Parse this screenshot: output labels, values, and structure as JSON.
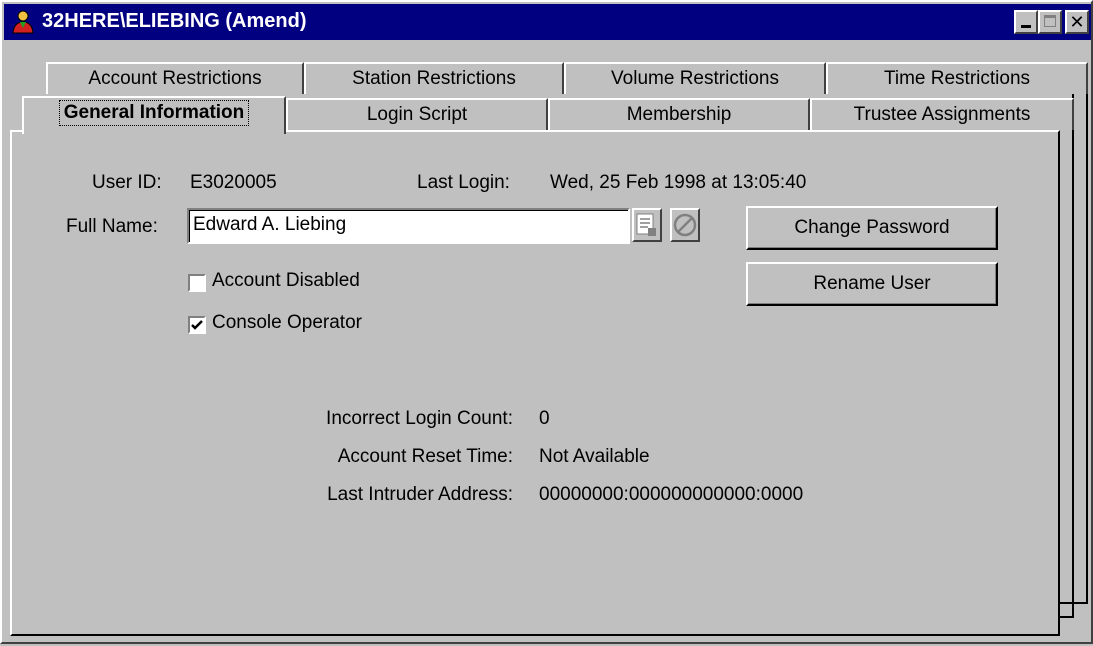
{
  "window": {
    "title": "32HERE\\ELIEBING (Amend)",
    "icon": "user-icon"
  },
  "tabs": {
    "row1": [
      "Account Restrictions",
      "Station Restrictions",
      "Volume Restrictions",
      "Time Restrictions"
    ],
    "row2": [
      "General Information",
      "Login Script",
      "Membership",
      "Trustee Assignments"
    ],
    "active": "General Information"
  },
  "general": {
    "user_id_label": "User ID:",
    "user_id_value": "E3020005",
    "last_login_label": "Last Login:",
    "last_login_value": "Wed, 25 Feb 1998 at 13:05:40",
    "full_name_label": "Full Name:",
    "full_name_value": "Edward A. Liebing",
    "account_disabled_label": "Account Disabled",
    "account_disabled_checked": false,
    "console_operator_label": "Console Operator",
    "console_operator_checked": true,
    "change_password_label": "Change Password",
    "rename_user_label": "Rename User",
    "incorrect_login_count_label": "Incorrect Login Count:",
    "incorrect_login_count_value": "0",
    "account_reset_time_label": "Account Reset Time:",
    "account_reset_time_value": "Not Available",
    "last_intruder_address_label": "Last Intruder Address:",
    "last_intruder_address_value": "00000000:000000000000:0000"
  },
  "colors": {
    "titlebar": "#000080",
    "face": "#c0c0c0"
  }
}
